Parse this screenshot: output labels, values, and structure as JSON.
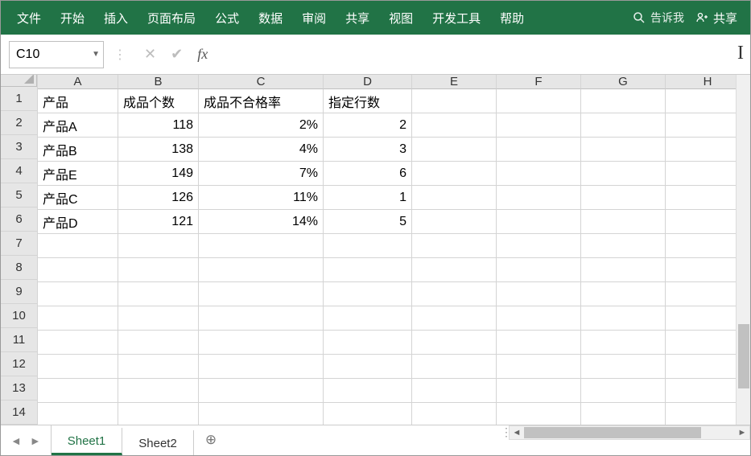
{
  "ribbon": {
    "items": [
      "文件",
      "开始",
      "插入",
      "页面布局",
      "公式",
      "数据",
      "审阅",
      "共享",
      "视图",
      "开发工具",
      "帮助"
    ],
    "tellme": "告诉我",
    "share": "共享"
  },
  "formulaBar": {
    "nameBox": "C10",
    "fxLabel": "fx",
    "formula": ""
  },
  "grid": {
    "columns": [
      "A",
      "B",
      "C",
      "D",
      "E",
      "F",
      "G",
      "H"
    ],
    "rowCount": 14,
    "data": [
      {
        "A": "产品",
        "B": "成品个数",
        "C": "成品不合格率",
        "D": "指定行数"
      },
      {
        "A": "产品A",
        "B": "118",
        "C": "2%",
        "D": "2"
      },
      {
        "A": "产品B",
        "B": "138",
        "C": "4%",
        "D": "3"
      },
      {
        "A": "产品E",
        "B": "149",
        "C": "7%",
        "D": "6"
      },
      {
        "A": "产品C",
        "B": "126",
        "C": "11%",
        "D": "1"
      },
      {
        "A": "产品D",
        "B": "121",
        "C": "14%",
        "D": "5"
      }
    ]
  },
  "sheets": {
    "tabs": [
      "Sheet1",
      "Sheet2"
    ],
    "active": 0
  }
}
